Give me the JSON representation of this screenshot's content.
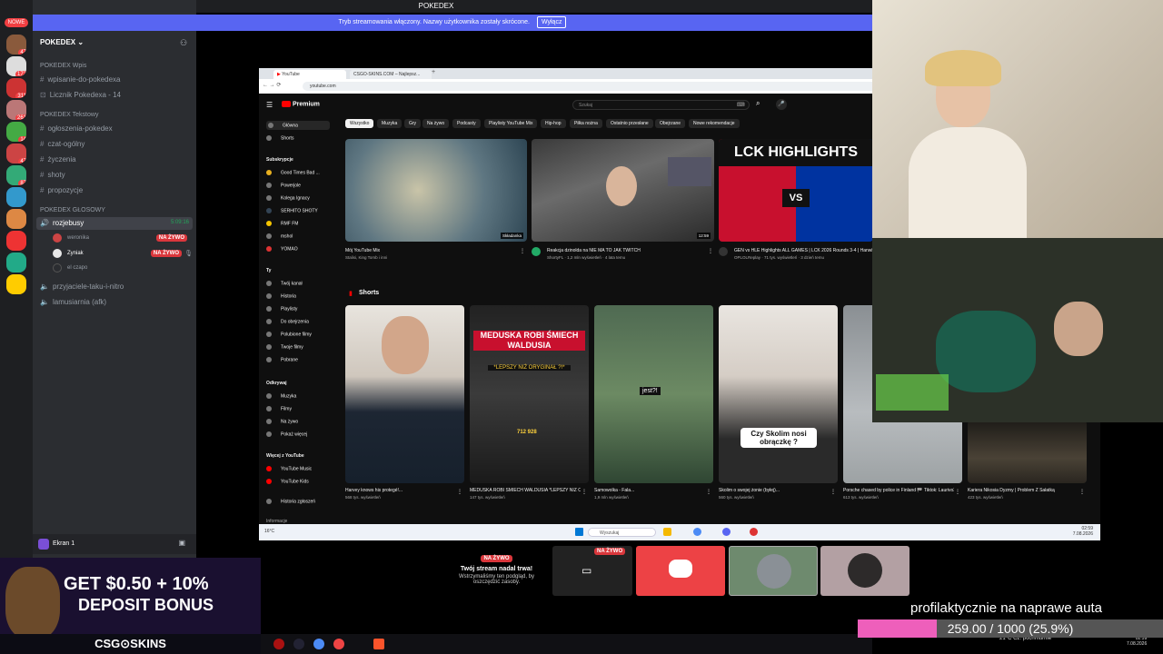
{
  "window_title": "POKEDEX",
  "stream_notice": {
    "text": "Tryb streamowania włączony. Nazwy użytkownika zostały skrócone.",
    "button": "Wyłącz"
  },
  "server": {
    "name": "POKEDEX",
    "new_badge": "NOWE"
  },
  "rail_badges": [
    "47",
    "172",
    "311",
    "261",
    "14",
    "47",
    "87"
  ],
  "categories": {
    "wpis": "POKEDEX Wpis",
    "tekstowy": "POKEDEX Tekstowy",
    "glosowy": "POKEDEX GŁOSOWY"
  },
  "channels_wpis": [
    "wpisanie-do-pokedexa",
    "Licznik Pokedexa - 14"
  ],
  "channels_text": [
    "ogłoszenia-pokedex",
    "czat-ogólny",
    "życzenia",
    "shoty",
    "propozycje"
  ],
  "voice": {
    "channel": "rozjebusy",
    "timer": "5:09:16",
    "users": [
      {
        "name": "weronika",
        "live": "NA ŻYWO"
      },
      {
        "name": "Zyniak",
        "live": "NA ŻYWO"
      },
      {
        "name": "el czapo",
        "live": ""
      }
    ],
    "others": [
      "przyjaciele-taku-i-nitro",
      "lamusiarnia (afk)"
    ]
  },
  "screen_share": "Ekran 1",
  "browser": {
    "tabs": [
      "YouTube",
      "CSGO-SKINS.COM – Najlepsz..."
    ],
    "url": "youtube.com"
  },
  "youtube": {
    "logo": "Premium",
    "search_placeholder": "Szukaj",
    "chips": [
      "Wszystko",
      "Muzyka",
      "Gry",
      "Na żywo",
      "Podcasty",
      "Playlisty YouTube Mix",
      "Hip-hop",
      "Piłka nożna",
      "Ostatnio przesłane",
      "Obejrzane",
      "Nowe rekomendacje"
    ],
    "nav_main": [
      "Główna",
      "Shorts"
    ],
    "subs_label": "Subskrypcje",
    "subs": [
      "Good Times Bad ...",
      "Powerjole",
      "Kolega Ignacy",
      "SERHITO SHOTY",
      "RMF FM",
      "mshol",
      "YOMAO"
    ],
    "you_label": "Ty",
    "you": [
      "Twój kanał",
      "Historia",
      "Playlisty",
      "Do obejrzenia",
      "Polubione filmy",
      "Twoje filmy",
      "Pobrane"
    ],
    "explore_label": "Odkrywaj",
    "explore": [
      "Muzyka",
      "Filmy",
      "Na żywo",
      "Pokaż więcej"
    ],
    "more_label": "Więcej z YouTube",
    "more": [
      "YouTube Music",
      "YouTube Kids"
    ],
    "report": "Historia zgłoszeń",
    "info": "Informacje",
    "videos": [
      {
        "title": "Mój YouTube Mix",
        "meta": "Stalisi, King Tomb i inni",
        "duration": "Składanka"
      },
      {
        "title": "Reakcja dzinolda na NIE MA TO JAK TWITCH",
        "meta": "ShortyFL · 1,2 mln wyświetleń · 4 lata temu",
        "duration": "12:59"
      },
      {
        "title": "GEN vs HLE Highlights ALL GAMES | LCK 2026 Rounds 3-4 | Hanwha Life Esports",
        "meta": "OPLOLReplay · 71 tys. wyświetleń · 3 dzień temu",
        "duration": ""
      }
    ],
    "lck_text": "LCK HIGHLIGHTS",
    "vs_text": "VS",
    "shorts_label": "Shorts",
    "shorts": [
      {
        "title": "Harvey knows his protegé!...",
        "meta": "568 tys. wyświetleń",
        "overlay": ""
      },
      {
        "title": "MEDUSKA ROBI ŚMIECH WALDUSIA *LEPSZY NIŻ ORYGINAŁ*...",
        "meta": "147 tys. wyświetleń",
        "overlay": "MEDUSKA ROBI ŚMIECH WALDUSIA"
      },
      {
        "title": "Samowolka - Fala...",
        "meta": "1,9 mln wyświetleń",
        "overlay": "jest?!"
      },
      {
        "title": "Skolim o swojej żonie (byłej)...",
        "meta": "560 tys. wyświetleń",
        "overlay": "Czy Skolim nosi obrączkę ?"
      },
      {
        "title": "Porsche chased by police in Finland 🏁 Tiktok: Laurivo3",
        "meta": "613 tys. wyświetleń",
        "overlay": ""
      },
      {
        "title": "Kariera Nikosia Dyzmy | Problem Z Sałatką",
        "meta": "423 tys. wyświetleń",
        "overlay": ""
      }
    ],
    "short_overlay2": "*LEPSZY NIŻ ORYGINAŁ ?!*",
    "short_views": "712 928"
  },
  "taskbar": {
    "search": "Wyszukaj",
    "weather": "16°C",
    "time": "02:59",
    "date": "7.08.2026"
  },
  "bottom_taskbar": {
    "weather": "21°C Cz. pochmurnie",
    "time": "02:59",
    "date": "7.08.2026"
  },
  "stream_paused": {
    "title": "Twój stream nadal trwa!",
    "text": "Wstrzymaliśmy ten podgląd, by oszczędzić zasoby.",
    "live": "NA ŻYWO"
  },
  "tile_live": "NA ŻYWO",
  "ad": {
    "line1": "GET $0.50 + 10%",
    "line2": "DEPOSIT BONUS",
    "brand": "CSG⊙SKINS"
  },
  "goal": {
    "label": "profilaktycznie na naprawe auta",
    "text": "259.00 / 1000 (25.9%)",
    "fraction": 0.259
  },
  "colors": {
    "discord_blurple": "#5865f2",
    "live_red": "#da373c",
    "progress_pink": "#ee5fbb"
  }
}
